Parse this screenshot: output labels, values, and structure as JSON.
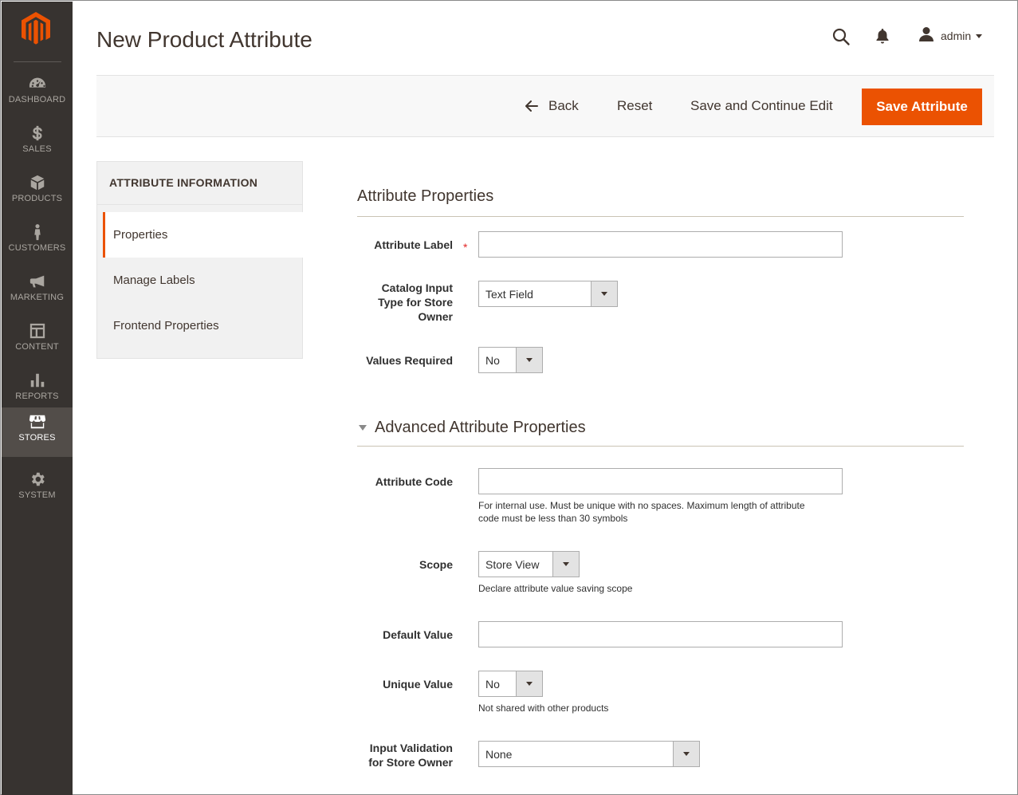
{
  "sidebar": {
    "items": [
      {
        "label": "DASHBOARD",
        "icon": "dashboard-icon"
      },
      {
        "label": "SALES",
        "icon": "dollar-icon"
      },
      {
        "label": "PRODUCTS",
        "icon": "box-icon"
      },
      {
        "label": "CUSTOMERS",
        "icon": "person-icon"
      },
      {
        "label": "MARKETING",
        "icon": "megaphone-icon"
      },
      {
        "label": "CONTENT",
        "icon": "layout-icon"
      },
      {
        "label": "REPORTS",
        "icon": "bar-chart-icon"
      },
      {
        "label": "STORES",
        "icon": "storefront-icon",
        "active": true
      },
      {
        "label": "SYSTEM",
        "icon": "gear-icon"
      }
    ]
  },
  "header": {
    "title": "New Product Attribute",
    "user": "admin"
  },
  "toolbar": {
    "back_label": "Back",
    "reset_label": "Reset",
    "save_continue_label": "Save and Continue Edit",
    "save_label": "Save Attribute"
  },
  "tabs": {
    "title": "ATTRIBUTE INFORMATION",
    "items": [
      "Properties",
      "Manage Labels",
      "Frontend Properties"
    ]
  },
  "form": {
    "section1_title": "Attribute Properties",
    "section2_title": "Advanced Attribute Properties",
    "attribute_label": {
      "label": "Attribute Label",
      "value": ""
    },
    "catalog_input": {
      "label_lines": [
        "Catalog Input",
        "Type for Store",
        "Owner"
      ],
      "value": "Text Field"
    },
    "values_required": {
      "label": "Values Required",
      "value": "No"
    },
    "attribute_code": {
      "label": "Attribute Code",
      "value": "",
      "note_lines": [
        "For internal use. Must be unique with no spaces. Maximum length of attribute",
        "code must be less than 30 symbols"
      ]
    },
    "scope": {
      "label": "Scope",
      "value": "Store View",
      "note": "Declare attribute value saving scope"
    },
    "default_value": {
      "label": "Default Value",
      "value": ""
    },
    "unique_value": {
      "label": "Unique Value",
      "value": "No",
      "note": "Not shared with other products"
    },
    "input_validation": {
      "label_lines": [
        "Input Validation",
        "for Store Owner"
      ],
      "value": "None"
    }
  },
  "colors": {
    "sidebar_bg": "#373330",
    "sidebar_active": "#524d49",
    "accent": "#eb5202"
  }
}
